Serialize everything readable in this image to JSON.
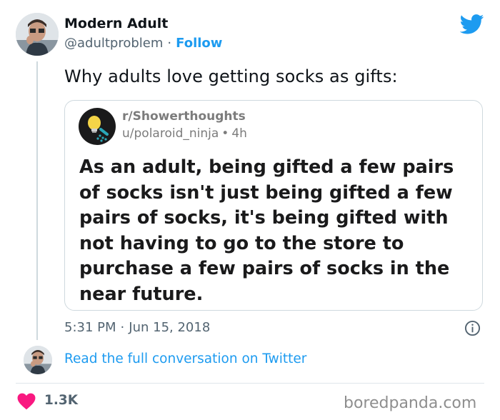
{
  "tweet": {
    "author_name": "Modern Adult",
    "handle": "@adultproblem",
    "separator": "·",
    "follow_label": "Follow",
    "text": "Why adults love getting socks as gifts:",
    "timestamp_time": "5:31 PM",
    "timestamp_date": "Jun 15, 2018",
    "likes": "1.3K",
    "read_more": "Read the full conversation on Twitter"
  },
  "reddit_card": {
    "subreddit": "r/Showerthoughts",
    "user": "u/polaroid_ninja",
    "bullet": "•",
    "age": "4h",
    "post_text": "As an adult, being gifted a few pairs of socks isn't just being gifted a few pairs of socks, it's being gifted with not having to go to the store to purchase a few pairs of socks in the near future."
  },
  "watermark": "boredpanda.com",
  "icons": {
    "bird": "twitter-bird-icon",
    "info": "info-icon",
    "heart": "heart-icon",
    "showerthoughts": "lightbulb-shower-icon"
  },
  "colors": {
    "twitter_blue": "#1d9bf0",
    "heart_red": "#f91880",
    "text_dark": "#0f1419",
    "text_gray": "#536471",
    "reddit_gray": "#7c7c7c",
    "icon_bg": "#1a1a1b"
  }
}
